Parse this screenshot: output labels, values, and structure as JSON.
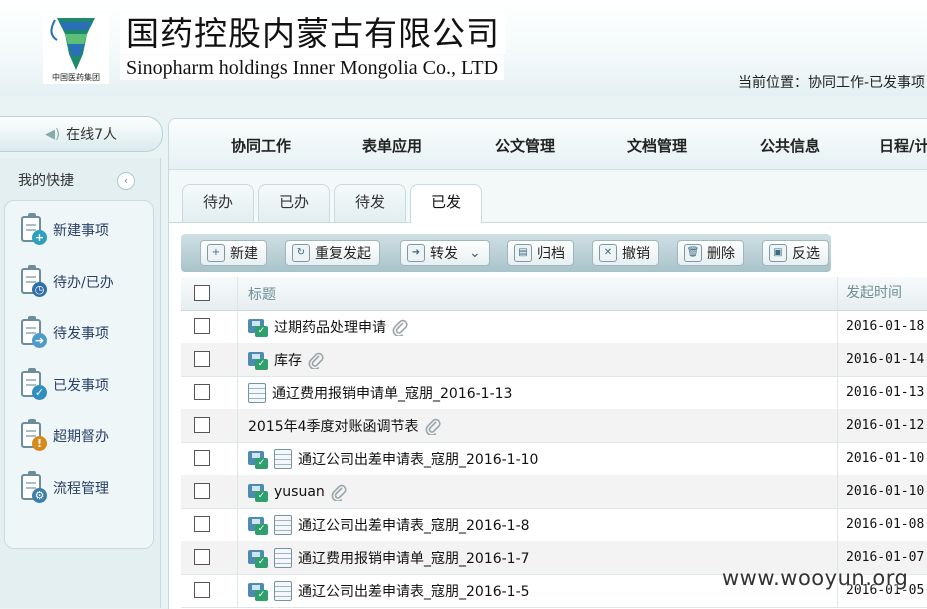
{
  "header": {
    "company_cn": "国药控股内蒙古有限公司",
    "company_en": "Sinopharm holdings Inner Mongolia Co., LTD",
    "logo_text": "中国医药集团",
    "location": "当前位置：协同工作-已发事项"
  },
  "sidebar": {
    "online": "在线7人",
    "title": "我的快捷",
    "items": [
      {
        "label": "新建事项",
        "icon": "new-item-icon",
        "badge": "+",
        "badge_color": "#2f9fbf"
      },
      {
        "label": "待办/已办",
        "icon": "pending-done-icon",
        "badge": "◷",
        "badge_color": "#2f6fa8"
      },
      {
        "label": "待发事项",
        "icon": "to-send-icon",
        "badge": "➜",
        "badge_color": "#4d9bc9"
      },
      {
        "label": "已发事项",
        "icon": "sent-icon",
        "badge": "✓",
        "badge_color": "#2f8fbf"
      },
      {
        "label": "超期督办",
        "icon": "overdue-icon",
        "badge": "!",
        "badge_color": "#d68a1c"
      },
      {
        "label": "流程管理",
        "icon": "workflow-icon",
        "badge": "⚙",
        "badge_color": "#3d7fa8"
      }
    ]
  },
  "topnav": [
    "协同工作",
    "表单应用",
    "公文管理",
    "文档管理",
    "公共信息",
    "日程/计"
  ],
  "tabs": [
    {
      "label": "待办",
      "active": false
    },
    {
      "label": "已办",
      "active": false
    },
    {
      "label": "待发",
      "active": false
    },
    {
      "label": "已发",
      "active": true
    }
  ],
  "toolbar": [
    {
      "label": "新建",
      "icon": "new-icon",
      "glyph": "+"
    },
    {
      "label": "重复发起",
      "icon": "resend-icon",
      "glyph": "↻"
    },
    {
      "label": "转发",
      "icon": "forward-icon",
      "glyph": "➜",
      "dropdown": true
    },
    {
      "label": "归档",
      "icon": "archive-icon",
      "glyph": "▤"
    },
    {
      "label": "撤销",
      "icon": "revoke-icon",
      "glyph": "✕"
    },
    {
      "label": "删除",
      "icon": "delete-icon",
      "glyph": "🗑"
    },
    {
      "label": "反选",
      "icon": "invert-select-icon",
      "glyph": "▣"
    }
  ],
  "table": {
    "columns": [
      "标题",
      "发起时间"
    ],
    "rows": [
      {
        "title": "过期药品处理申请",
        "date": "2016-01-18",
        "person": true,
        "form": false,
        "attach": true
      },
      {
        "title": "库存",
        "date": "2016-01-14",
        "person": true,
        "form": false,
        "attach": true
      },
      {
        "title": "通辽费用报销申请单_寇朋_2016-1-13",
        "date": "2016-01-13",
        "person": false,
        "form": true,
        "attach": false
      },
      {
        "title": "2015年4季度对账函调节表",
        "date": "2016-01-12",
        "person": false,
        "form": false,
        "attach": true
      },
      {
        "title": "通辽公司出差申请表_寇朋_2016-1-10",
        "date": "2016-01-10",
        "person": true,
        "form": true,
        "attach": false
      },
      {
        "title": "yusuan",
        "date": "2016-01-10",
        "person": true,
        "form": false,
        "attach": true
      },
      {
        "title": "通辽公司出差申请表_寇朋_2016-1-8",
        "date": "2016-01-08",
        "person": true,
        "form": true,
        "attach": false
      },
      {
        "title": "通辽费用报销申请单_寇朋_2016-1-7",
        "date": "2016-01-07",
        "person": true,
        "form": true,
        "attach": false
      },
      {
        "title": "通辽公司出差申请表_寇朋_2016-1-5",
        "date": "2016-01-05",
        "person": true,
        "form": true,
        "attach": false
      }
    ]
  },
  "watermark": "www.wooyun.org"
}
